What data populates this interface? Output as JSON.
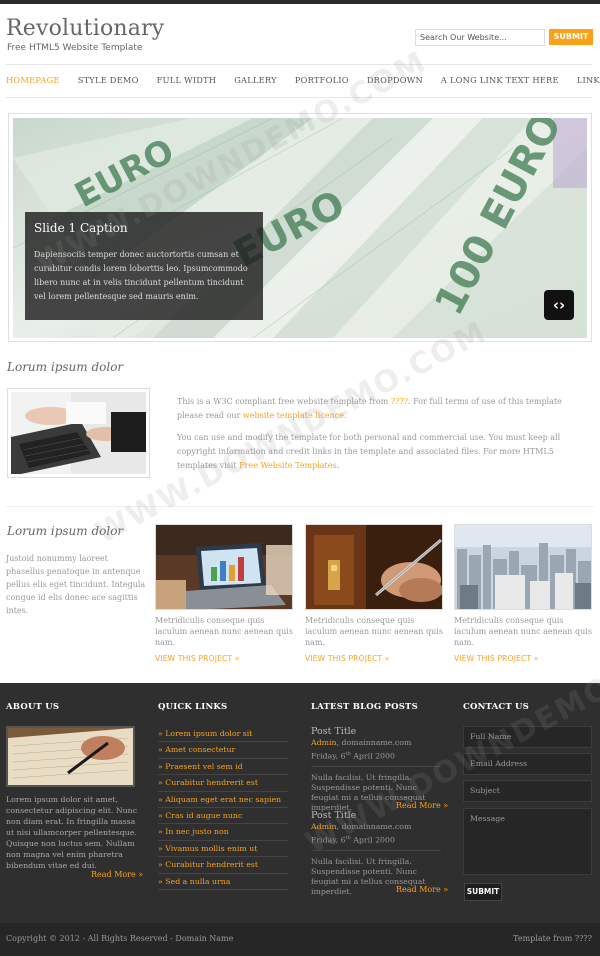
{
  "header": {
    "logo": "Revolutionary",
    "tagline": "Free HTML5 Website Template",
    "search_placeholder": "Search Our Website...",
    "search_button": "SUBMIT"
  },
  "nav": {
    "items": [
      {
        "label": "HOMEPAGE",
        "active": true
      },
      {
        "label": "STYLE DEMO",
        "active": false
      },
      {
        "label": "FULL WIDTH",
        "active": false
      },
      {
        "label": "GALLERY",
        "active": false
      },
      {
        "label": "PORTFOLIO",
        "active": false
      },
      {
        "label": "DROPDOWN",
        "active": false
      },
      {
        "label": "A LONG LINK TEXT HERE",
        "active": false
      },
      {
        "label": "LINK TEXT",
        "active": false
      }
    ]
  },
  "slider": {
    "caption_title": "Slide 1 Caption",
    "caption_text": "Dapiensociis temper donec auctortortis cumsan et curabitur condis lorem loborttis leo. Ipsumcommodo libero nunc at in velis tincidunt pellentum tincidunt vel lorem pellentesque sed mauris enim.",
    "nav_glyph": "‹›",
    "banknote_words": [
      "EURO",
      "EURO",
      "100 EURO"
    ]
  },
  "intro": {
    "heading": "Lorum ipsum dolor",
    "para1_pre": "This is a W3C compliant free website template from ",
    "para1_link1": "????",
    "para1_mid": ". For full terms of use of this template please read our ",
    "para1_link2": "website template licence",
    "para1_post": ".",
    "para2_pre": "You can use and modify the template for both personal and commercial use. You must keep all copyright information and credit links in the template and associated files. For more HTML5 templates visit ",
    "para2_link": "Free Website Templates",
    "para2_post": "."
  },
  "projects": {
    "heading": "Lorum ipsum dolor",
    "side_text": "Justoid nonummy laoreet phasellus penatoque in antenque pellus elis eget tincidunt. Integula congue id elis donec ace sagittis intes.",
    "items": [
      {
        "text": "Metridiculis conseque quis iaculum aenean nunc aenean quis nam.",
        "link": "VIEW THIS PROJECT »"
      },
      {
        "text": "Metridiculis conseque quis iaculum aenean nunc aenean quis nam.",
        "link": "VIEW THIS PROJECT »"
      },
      {
        "text": "Metridiculis conseque quis iaculum aenean nunc aenean quis nam.",
        "link": "VIEW THIS PROJECT »"
      }
    ]
  },
  "footer": {
    "about": {
      "heading": "ABOUT US",
      "text": "Lorem ipsum dolor sit amet, consectetur adipiscing elit. Nunc non diam erat. In fringilla massa ut nisi ullamcorper pellentesque. Quisque non luctus sem. Nullam non magna vel enim pharetra bibendum vitae ed dui.",
      "read_more": "Read More »"
    },
    "quick_links": {
      "heading": "QUICK LINKS",
      "items": [
        "» Lorem ipsum dolor sit",
        "» Amet consectetur",
        "» Praesent vel sem id",
        "» Curabitur hendrerit est",
        "» Aliquam eget erat nec sapien",
        "» Cras id augue nunc",
        "» In nec justo non",
        "» Vivamus mollis enim ut",
        "» Curabitur hendrerit est",
        "» Sed a nulla urna"
      ]
    },
    "blog": {
      "heading": "LATEST BLOG POSTS",
      "posts": [
        {
          "title": "Post Title",
          "author": "Admin",
          "site": ", domainname.com",
          "day": "Friday, 6",
          "sup": "th",
          "date_rest": " April 2000",
          "body": "Nulla facilisi. Ut fringilla. Suspendisse potenti. Nunc feugiat mi a tellus consequat imperdiet.",
          "read_more": "Read More »"
        },
        {
          "title": "Post Title",
          "author": "Admin",
          "site": ", domainname.com",
          "day": "Friday, 6",
          "sup": "th",
          "date_rest": " April 2000",
          "body": "Nulla facilisi. Ut fringilla. Suspendisse potenti. Nunc feugiat mi a tellus consequat imperdiet.",
          "read_more": "Read More »"
        }
      ]
    },
    "contact": {
      "heading": "CONTACT US",
      "full_name": "Full Name",
      "email": "Email Address",
      "subject": "Subject",
      "message": "Message",
      "submit": "SUBMIT"
    }
  },
  "bottom": {
    "copyright": "Copyright © 2012 - All Rights Reserved - Domain Name",
    "credit": "Template from ????"
  },
  "watermark": "WWW.DOWNDEMO.COM",
  "colors": {
    "accent": "#f9a21a",
    "footer_bg": "#2f2f2f",
    "bottom_bg": "#262626"
  }
}
